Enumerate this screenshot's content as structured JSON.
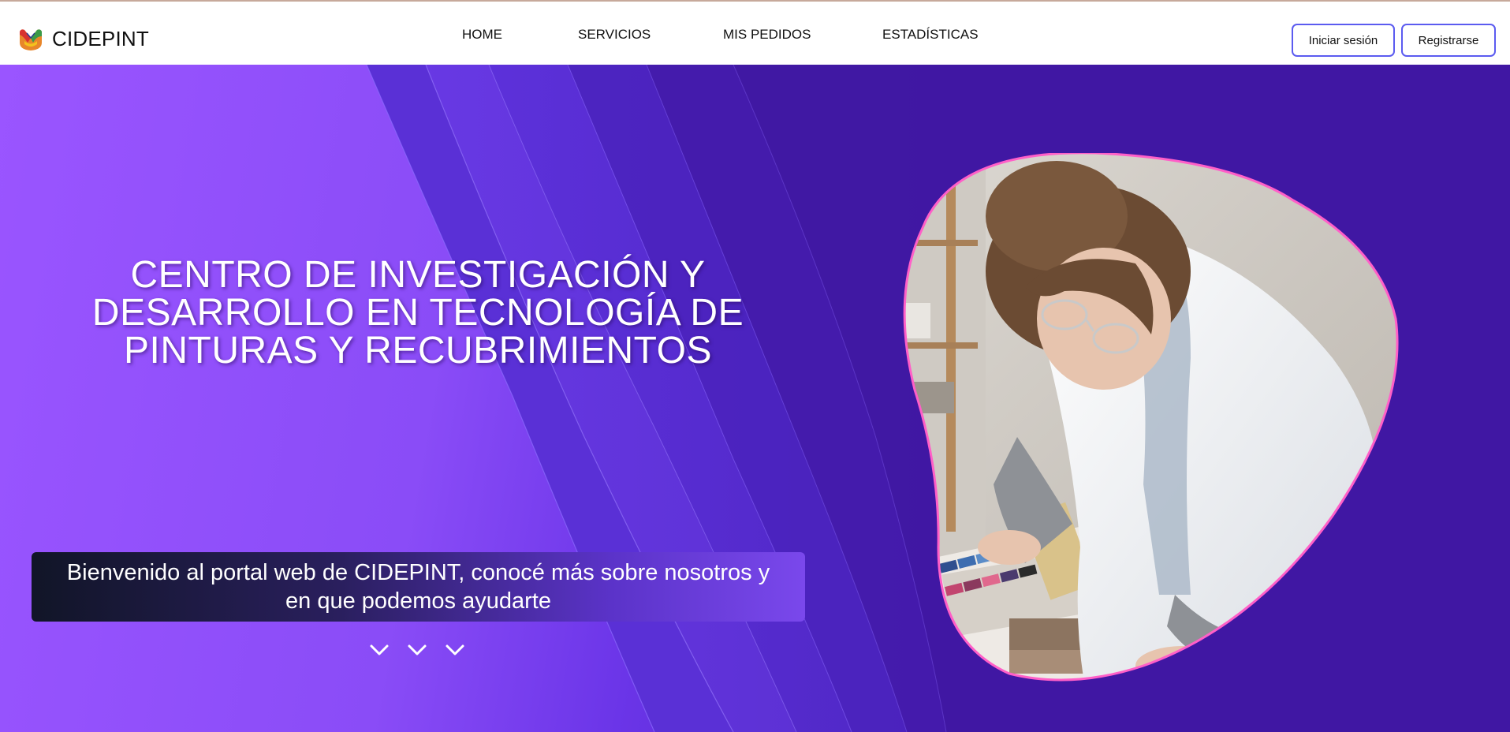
{
  "header": {
    "brand_name": "CIDEPINT",
    "logo_icon": "cidepint-logo-icon",
    "nav": {
      "home": "HOME",
      "services": "SERVICIOS",
      "orders": "MIS PEDIDOS",
      "stats": "ESTADÍSTICAS"
    },
    "login_label": "Iniciar sesión",
    "register_label": "Registrarse"
  },
  "hero": {
    "title_line1": "CENTRO DE INVESTIGACIÓN Y",
    "title_line2": "DESARROLLO EN TECNOLOGÍA DE",
    "title_line3": "PINTURAS Y RECUBRIMIENTOS",
    "welcome_line1": "Bienvenido al portal web de CIDEPINT, conocé más sobre nosotros y",
    "welcome_line2": "en que podemos ayudarte",
    "scroll_icon": "chevron-down-icon",
    "image_icon": "researcher-color-swatches-photo"
  },
  "colors": {
    "accent": "#5b5bf0",
    "hero_purple": "#8a4cf7",
    "photo_border": "#ff5fc8"
  }
}
